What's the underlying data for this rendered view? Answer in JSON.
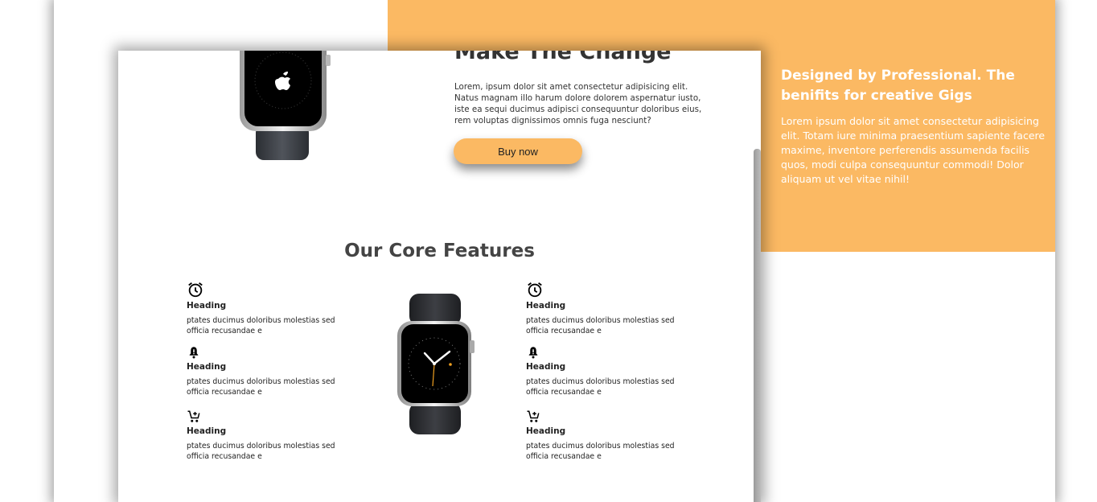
{
  "promo": {
    "title": "Designed by Professional. The benifits for creative Gigs",
    "text": "Lorem ipsum dolor sit amet consectetur adipisicing elit. Totam iure minima praesentium sapiente facere maxime, inventore perferendis assumenda facilis quos, modi culpa consequuntur commodi! Dolor aliquam ut vel vitae nihil!"
  },
  "hero": {
    "title": "Make The Change",
    "text": "Lorem, ipsum dolor sit amet consectetur adipisicing elit. Natus magnam illo harum dolore dolorem aspernatur iusto, iste ea sequi ducimus adipisci consequuntur doloribus eius, rem voluptas dignissimos omnis fuga nesciunt?",
    "button_label": "Buy now"
  },
  "features": {
    "title": "Our Core Features",
    "left": [
      {
        "icon": "alarm-clock-icon",
        "heading": "Heading",
        "text": "ptates ducimus doloribus molestias sed officia recusandae e"
      },
      {
        "icon": "bell-alert-icon",
        "heading": "Heading",
        "text": "ptates ducimus doloribus molestias sed officia recusandae e"
      },
      {
        "icon": "add-cart-icon",
        "heading": "Heading",
        "text": "ptates ducimus doloribus molestias sed officia recusandae e"
      }
    ],
    "right": [
      {
        "icon": "alarm-clock-icon",
        "heading": "Heading",
        "text": "ptates ducimus doloribus molestias sed officia recusandae e"
      },
      {
        "icon": "bell-alert-icon",
        "heading": "Heading",
        "text": "ptates ducimus doloribus molestias sed officia recusandae e"
      },
      {
        "icon": "add-cart-icon",
        "heading": "Heading",
        "text": "ptates ducimus doloribus molestias sed officia recusandae e"
      }
    ]
  },
  "colors": {
    "accent": "#fbb963",
    "text": "#333333"
  }
}
